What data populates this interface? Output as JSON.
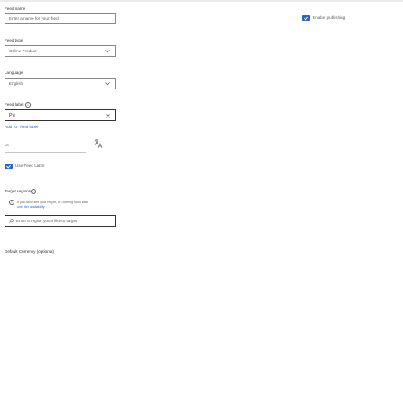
{
  "form": {
    "feed_name": {
      "label": "Feed name",
      "placeholder": "Enter a name for your feed"
    },
    "enable_publishing": {
      "label": "Enable publishing",
      "checked": true
    },
    "feed_type": {
      "label": "Feed type",
      "value": "Online Product"
    },
    "language": {
      "label": "Language",
      "value": "English"
    },
    "feed_label": {
      "label": "Feed label",
      "value": "Pu",
      "hint": "Add \"U\" feed label"
    },
    "country": {
      "value": "us"
    },
    "use_feed_label": {
      "label": "Use Feed Label",
      "checked": true
    },
    "target_regions": {
      "label": "Target regions",
      "notice": "If you don't see your region, it's coming soon with",
      "notice2": "over tier availability",
      "placeholder": "Enter a region you'd like to target"
    },
    "default_currency": {
      "label": "Default Currency (optional)"
    }
  },
  "icons": {
    "info": "info-icon",
    "chevron": "chevron-down-icon",
    "clear": "close-icon",
    "search": "search-icon",
    "checkbox": "checkbox-checked-icon",
    "language_picker": "language-picker-icon"
  },
  "colors": {
    "accent": "#2b64c8",
    "border": "#8a8886",
    "text": "#605e5c"
  }
}
